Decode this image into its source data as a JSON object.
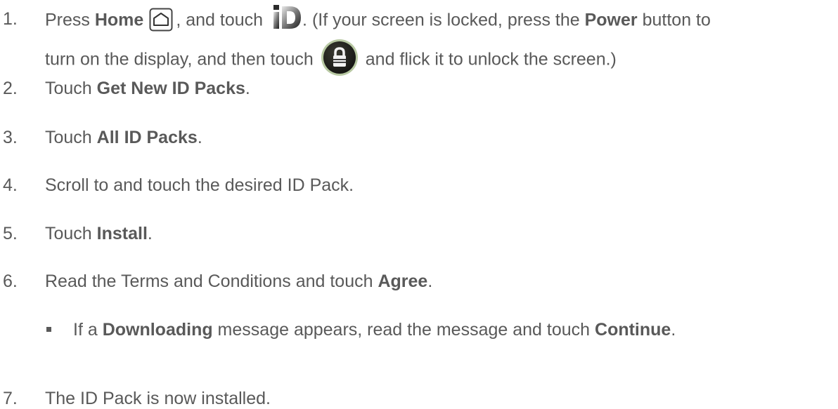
{
  "steps": [
    {
      "num": "1.",
      "t1": "Press ",
      "b1": "Home",
      "t2": ", and touch",
      "t3": ". (If your screen is locked, press the ",
      "b2": "Power",
      "t4": " button to",
      "line2a": "turn on the display, and then touch",
      "line2b": "and flick it to unlock the screen.)",
      "icons": [
        "home-key-icon",
        "id-app-icon",
        "lock-screen-icon"
      ]
    },
    {
      "num": "2.",
      "t1": "Touch ",
      "b1": "Get New ID Packs",
      "t2": "."
    },
    {
      "num": "3.",
      "t1": "Touch ",
      "b1": "All ID Packs",
      "t2": "."
    },
    {
      "num": "4.",
      "t1": "Scroll to and touch the desired ID Pack."
    },
    {
      "num": "5.",
      "t1": "Touch ",
      "b1": "Install",
      "t2": "."
    },
    {
      "num": "6.",
      "t1": "Read the Terms and Conditions and touch ",
      "b1": "Agree",
      "t2": "."
    },
    {
      "t1": "If a ",
      "b1": "Downloading",
      "t2": " message appears, read the message and touch ",
      "b2": "Continue",
      "t3": "."
    },
    {
      "num": "7.",
      "t1": "The ID Pack is now installed."
    }
  ]
}
